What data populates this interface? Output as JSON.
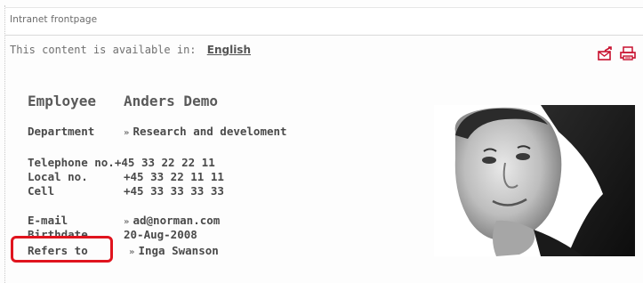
{
  "breadcrumb": {
    "label": "Intranet frontpage"
  },
  "language": {
    "prefix": "This content is available in:",
    "link": "English"
  },
  "toolbar": {
    "email_icon": "send-email-icon",
    "print_icon": "print-icon"
  },
  "employee": {
    "title_label": "Employee",
    "name": "Anders Demo",
    "department_label": "Department",
    "department": "Research and develoment",
    "telephone_label": "Telephone no.",
    "telephone": "+45 33 22 22 11",
    "local_label": "Local no.",
    "local": "+45 33 22 11 11",
    "cell_label": "Cell",
    "cell": "+45 33 33 33 33",
    "email_label": "E-mail",
    "email": "ad@norman.com",
    "birthdate_label": "Birthdate",
    "birthdate": "20-Aug-2008",
    "refers_label": "Refers to",
    "refers": "Inga Swanson"
  },
  "colors": {
    "icon_red": "#c8102e",
    "highlight": "#e0141e"
  }
}
